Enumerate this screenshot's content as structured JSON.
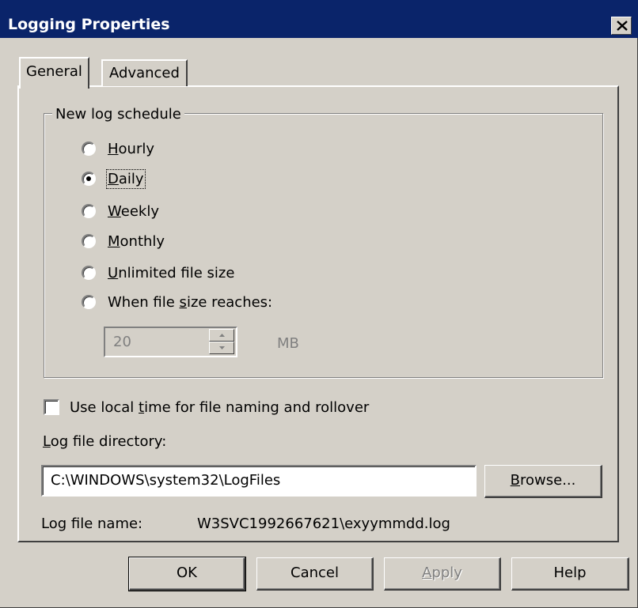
{
  "window": {
    "title": "Logging Properties"
  },
  "tabs": [
    {
      "label": "General",
      "selected": true
    },
    {
      "label": "Advanced",
      "selected": false
    }
  ],
  "schedule": {
    "legend": "New log schedule",
    "options": [
      {
        "pre": "",
        "accel": "H",
        "post": "ourly",
        "selected": false
      },
      {
        "pre": "",
        "accel": "D",
        "post": "aily",
        "selected": true
      },
      {
        "pre": "",
        "accel": "W",
        "post": "eekly",
        "selected": false
      },
      {
        "pre": "",
        "accel": "M",
        "post": "onthly",
        "selected": false
      },
      {
        "pre": "",
        "accel": "U",
        "post": "nlimited file size",
        "selected": false
      },
      {
        "pre": "When file ",
        "accel": "s",
        "post": "ize reaches:",
        "selected": false
      }
    ],
    "size_value": "20",
    "size_unit": "MB"
  },
  "local_time": {
    "pre": "Use local ",
    "accel": "t",
    "post": "ime for file naming and rollover",
    "checked": false
  },
  "directory": {
    "label_accel": "L",
    "label_post": "og file directory:",
    "value": "C:\\WINDOWS\\system32\\LogFiles",
    "browse_accel": "B",
    "browse_post": "rowse..."
  },
  "file_name": {
    "label": "Log file name:",
    "value": "W3SVC1992667621\\exyymmdd.log"
  },
  "buttons": {
    "ok": "OK",
    "cancel": "Cancel",
    "apply_accel": "A",
    "apply_post": "pply",
    "help": "Help"
  },
  "colors": {
    "titlebar": "#0a246a",
    "face": "#d4d0c8",
    "disabled_text": "#808080"
  }
}
